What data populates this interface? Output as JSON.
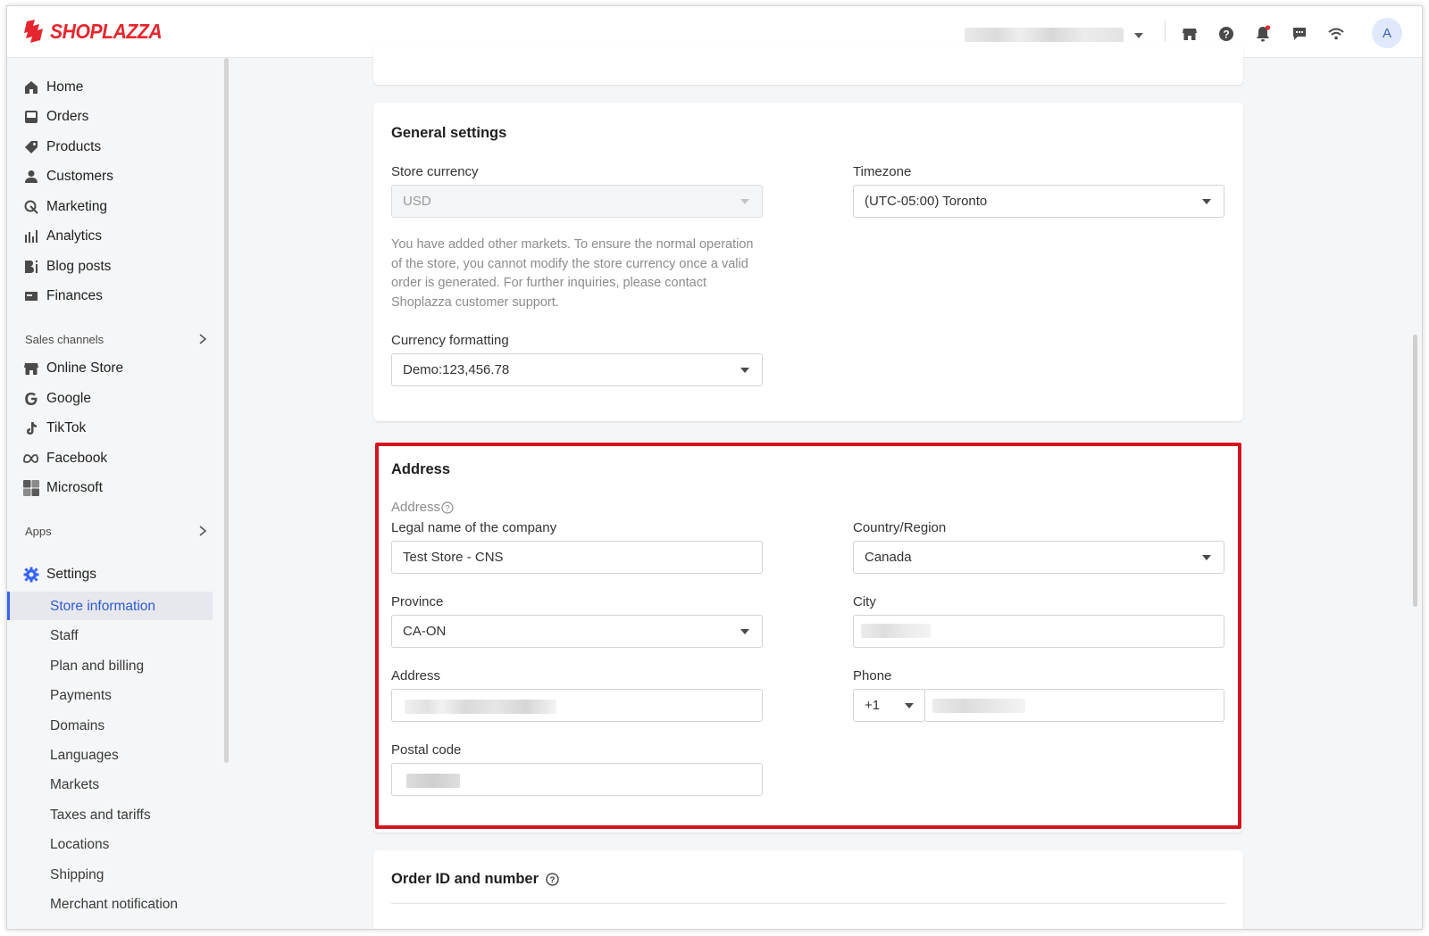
{
  "brand": {
    "name": "SHOPLAZZA",
    "color": "#e6262e"
  },
  "topbar": {
    "icons": [
      "store-icon",
      "help-icon",
      "bell-icon",
      "chat-icon",
      "wifi-icon"
    ],
    "avatar_initial": "A"
  },
  "sidebar": {
    "items": [
      {
        "label": "Home",
        "icon": "home-icon"
      },
      {
        "label": "Orders",
        "icon": "orders-icon"
      },
      {
        "label": "Products",
        "icon": "tag-icon"
      },
      {
        "label": "Customers",
        "icon": "person-icon"
      },
      {
        "label": "Marketing",
        "icon": "marketing-icon"
      },
      {
        "label": "Analytics",
        "icon": "bar-chart-icon"
      },
      {
        "label": "Blog posts",
        "icon": "blog-icon"
      },
      {
        "label": "Finances",
        "icon": "finances-icon"
      }
    ],
    "sales_channels_label": "Sales channels",
    "channels": [
      {
        "label": "Online Store",
        "icon": "store-icon"
      },
      {
        "label": "Google",
        "icon": "google-icon"
      },
      {
        "label": "TikTok",
        "icon": "tiktok-icon"
      },
      {
        "label": "Facebook",
        "icon": "meta-icon"
      },
      {
        "label": "Microsoft",
        "icon": "microsoft-icon"
      }
    ],
    "apps_label": "Apps",
    "settings_label": "Settings",
    "settings_items": [
      "Store information",
      "Staff",
      "Plan and billing",
      "Payments",
      "Domains",
      "Languages",
      "Markets",
      "Taxes and tariffs",
      "Locations",
      "Shipping",
      "Merchant notification"
    ],
    "active_item": "Store information"
  },
  "general": {
    "title": "General settings",
    "currency_label": "Store currency",
    "currency_value": "USD",
    "currency_help": "You have added other markets. To ensure the normal operation of the store, you cannot modify the store currency once a valid order is generated. For further inquiries, please contact Shoplazza customer support.",
    "timezone_label": "Timezone",
    "timezone_value": "(UTC-05:00) Toronto",
    "format_label": "Currency formatting",
    "format_value": "Demo:123,456.78"
  },
  "address": {
    "title": "Address",
    "subheading": "Address",
    "legal_name_label": "Legal name of the company",
    "legal_name_value": "Test Store - CNS",
    "country_label": "Country/Region",
    "country_value": "Canada",
    "province_label": "Province",
    "province_value": "CA-ON",
    "city_label": "City",
    "address_label": "Address",
    "phone_label": "Phone",
    "phone_code": "+1",
    "postal_label": "Postal code"
  },
  "order": {
    "title": "Order ID and number"
  },
  "colors": {
    "accent": "#3665f3",
    "highlight": "#d3151e"
  }
}
